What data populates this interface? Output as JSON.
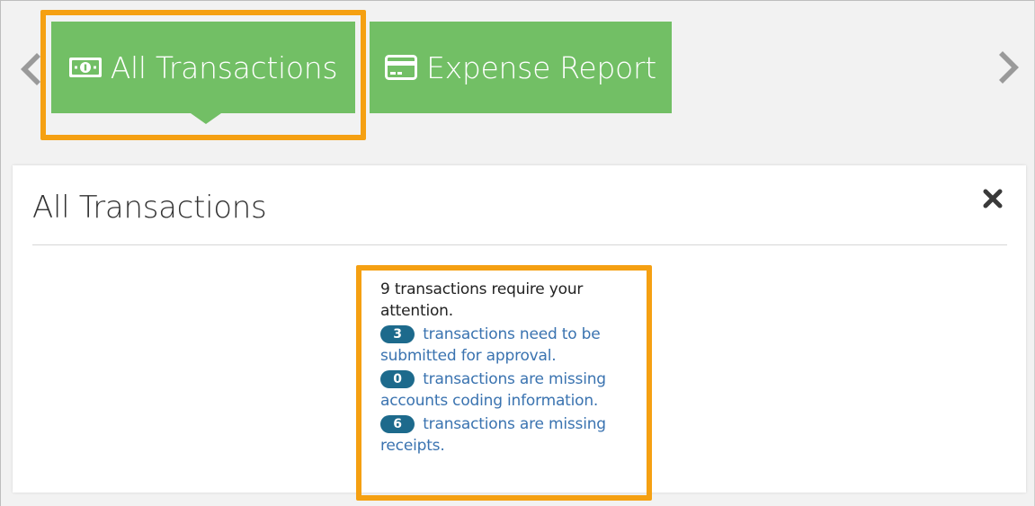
{
  "tabs": [
    {
      "label": "All Transactions",
      "icon": "money-icon",
      "selected": true
    },
    {
      "label": "Expense Report",
      "icon": "credit-card-icon",
      "selected": false
    }
  ],
  "panel": {
    "title": "All Transactions",
    "summary": {
      "intro": "9 transactions require your attention.",
      "items": [
        {
          "count": "3",
          "text": "transactions need to be submitted for approval."
        },
        {
          "count": "0",
          "text": "transactions are missing accounts coding information."
        },
        {
          "count": "6",
          "text": "transactions are missing receipts."
        }
      ]
    }
  },
  "colors": {
    "tab_green": "#72bf65",
    "highlight_orange": "#f5a012",
    "badge_blue": "#1d6a8c",
    "link_blue": "#3a73b0"
  }
}
